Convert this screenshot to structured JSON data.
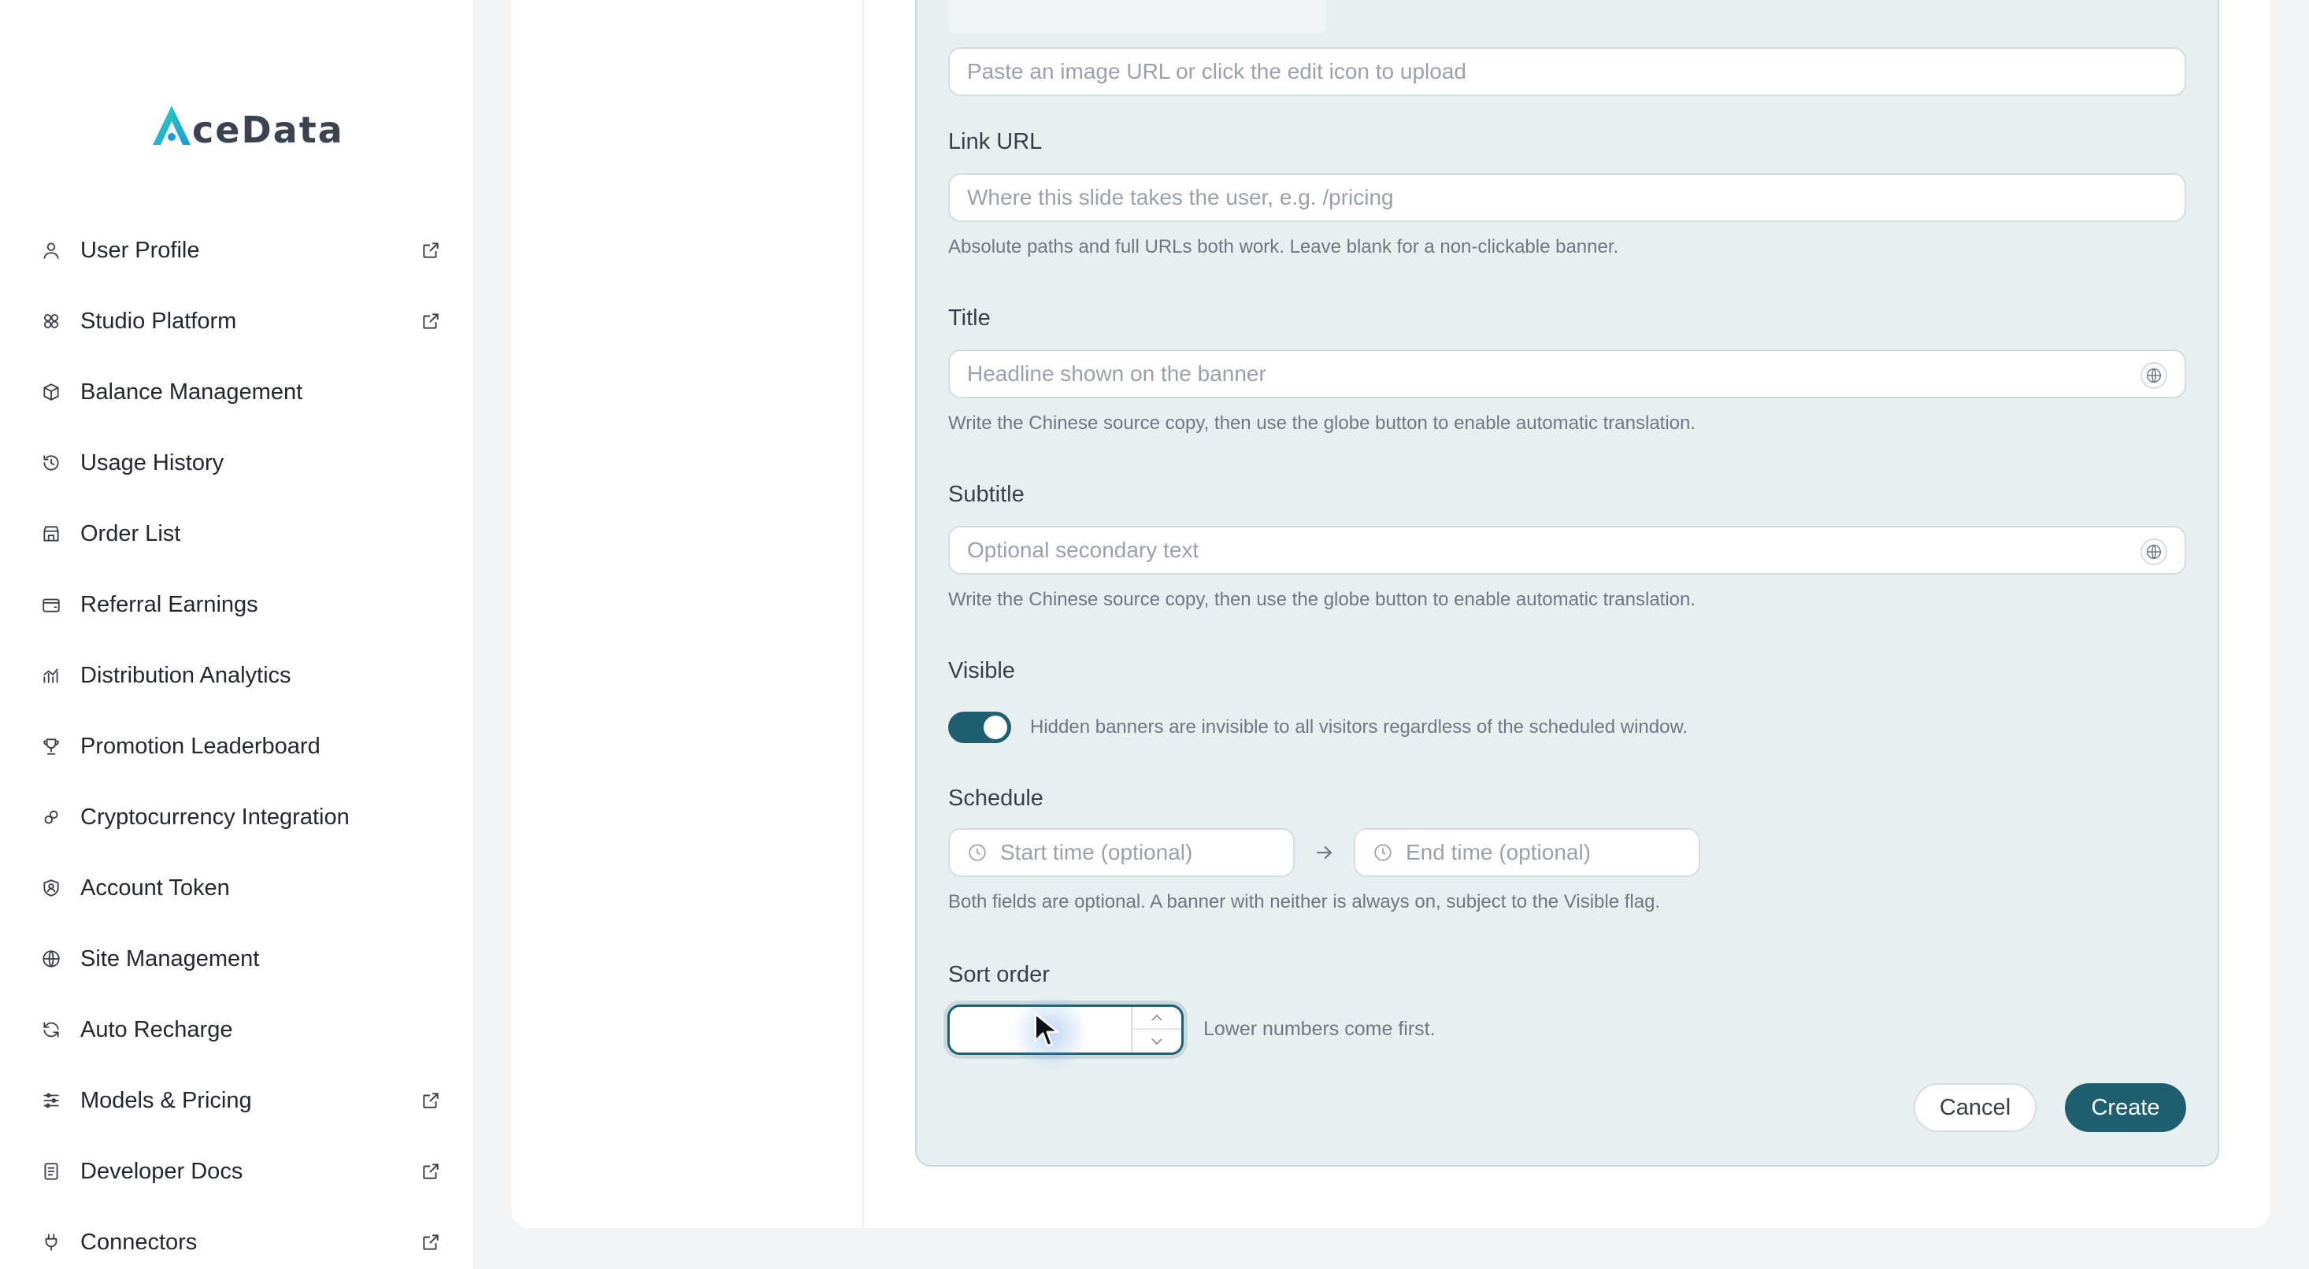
{
  "brand": {
    "logo_text": "ceData",
    "logo_letter": "A",
    "accent": "#1fb5c9"
  },
  "sidebar": {
    "items": [
      {
        "label": "User Profile",
        "icon": "user-icon",
        "external": true
      },
      {
        "label": "Studio Platform",
        "icon": "cubes-icon",
        "external": true
      },
      {
        "label": "Balance Management",
        "icon": "box-icon",
        "external": false
      },
      {
        "label": "Usage History",
        "icon": "history-icon",
        "external": false
      },
      {
        "label": "Order List",
        "icon": "store-icon",
        "external": false
      },
      {
        "label": "Referral Earnings",
        "icon": "wallet-icon",
        "external": false
      },
      {
        "label": "Distribution Analytics",
        "icon": "chart-icon",
        "external": false
      },
      {
        "label": "Promotion Leaderboard",
        "icon": "trophy-icon",
        "external": false
      },
      {
        "label": "Cryptocurrency Integration",
        "icon": "crypto-link-icon",
        "external": false
      },
      {
        "label": "Account Token",
        "icon": "shield-user-icon",
        "external": false
      },
      {
        "label": "Site Management",
        "icon": "globe-icon",
        "external": false
      },
      {
        "label": "Auto Recharge",
        "icon": "refresh-icon",
        "external": false
      },
      {
        "label": "Models & Pricing",
        "icon": "sliders-icon",
        "external": true
      },
      {
        "label": "Developer Docs",
        "icon": "docs-icon",
        "external": true
      },
      {
        "label": "Connectors",
        "icon": "plug-icon",
        "external": true
      }
    ]
  },
  "form": {
    "image_url": {
      "placeholder": "Paste an image URL or click the edit icon to upload"
    },
    "link_url": {
      "label": "Link URL",
      "placeholder": "Where this slide takes the user, e.g. /pricing",
      "help": "Absolute paths and full URLs both work. Leave blank for a non-clickable banner."
    },
    "title": {
      "label": "Title",
      "placeholder": "Headline shown on the banner",
      "help": "Write the Chinese source copy, then use the globe button to enable automatic translation."
    },
    "subtitle": {
      "label": "Subtitle",
      "placeholder": "Optional secondary text",
      "help": "Write the Chinese source copy, then use the globe button to enable automatic translation."
    },
    "visible": {
      "label": "Visible",
      "on": true,
      "help": "Hidden banners are invisible to all visitors regardless of the scheduled window."
    },
    "schedule": {
      "label": "Schedule",
      "start_placeholder": "Start time (optional)",
      "end_placeholder": "End time (optional)",
      "help": "Both fields are optional. A banner with neither is always on, subject to the Visible flag."
    },
    "sort_order": {
      "label": "Sort order",
      "value": "",
      "help": "Lower numbers come first."
    },
    "actions": {
      "cancel": "Cancel",
      "create": "Create"
    }
  },
  "colors": {
    "primary": "#1f5f70",
    "panel": "#e8eff1",
    "border": "#c6d8de"
  }
}
